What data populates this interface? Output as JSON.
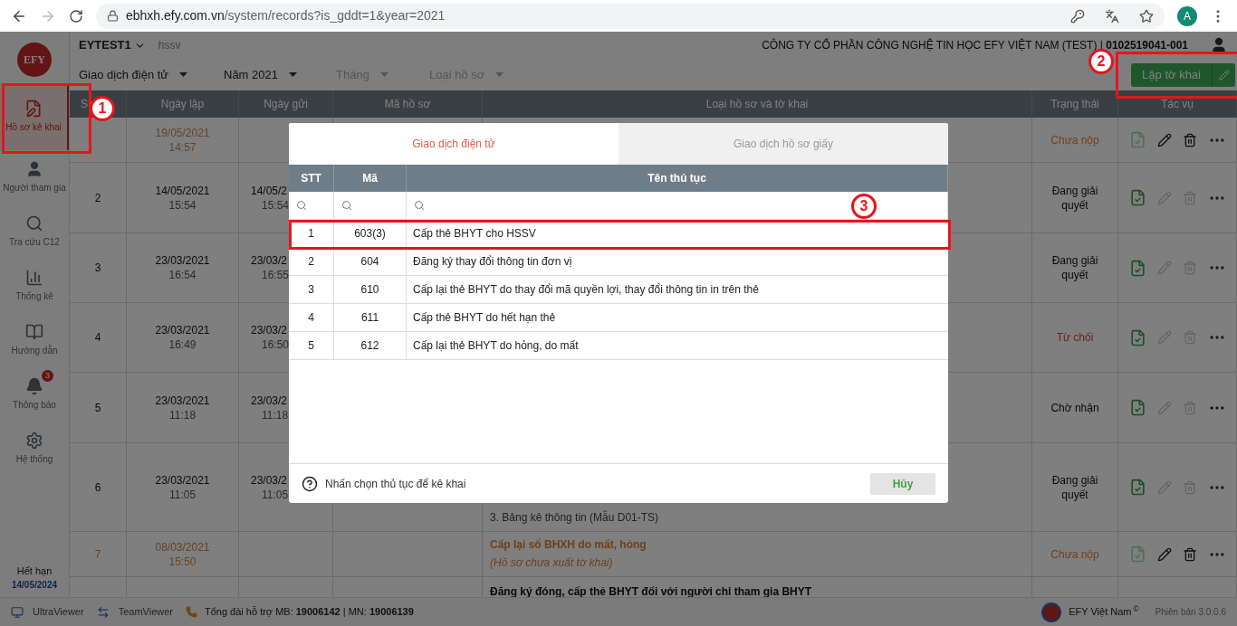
{
  "browser": {
    "url_host": "ebhxh.efy.com.vn",
    "url_path": "/system/records?is_gddt=1&year=2021",
    "avatar": "A"
  },
  "sidebar": {
    "logo": "EFY",
    "items": [
      {
        "label": "Hồ sơ kê khai",
        "selected": true
      },
      {
        "label": "Người tham gia",
        "selected": false
      },
      {
        "label": "Tra cứu C12",
        "selected": false
      },
      {
        "label": "Thống kê",
        "selected": false
      },
      {
        "label": "Hướng dẫn",
        "selected": false
      },
      {
        "label": "Thông báo",
        "badge": "3",
        "selected": false
      },
      {
        "label": "Hệ thống",
        "selected": false
      }
    ],
    "expiry_label": "Hết hạn",
    "expiry_date": "14/05/2024"
  },
  "topbar": {
    "account": "EYTEST1",
    "unit": "hssv",
    "company": "CÔNG TY CỔ PHẦN CÔNG NGHỆ TIN HỌC EFY VIỆT NAM (TEST) | **0102519041-001**"
  },
  "filters": [
    {
      "label": "Giao dịch điện tử",
      "kind": "value"
    },
    {
      "label": "Năm 2021",
      "kind": "value"
    },
    {
      "label": "Tháng",
      "kind": "placeholder"
    },
    {
      "label": "Loại hồ sơ",
      "kind": "placeholder"
    }
  ],
  "create_button": "Lập tờ khai",
  "table": {
    "columns": [
      "S",
      "Ngày lập",
      "Ngày gửi",
      "Mã hồ sơ",
      "Loại hồ sơ và tờ khai",
      "Trạng thái",
      "Tác vụ"
    ],
    "rows": [
      {
        "created_date": "19/05/2021",
        "created_time": "14:57",
        "status": "Chưa nộp",
        "kind": "draft"
      },
      {
        "stt": "2",
        "created_date": "14/05/2021",
        "created_time": "15:54",
        "sent_date": "14/05/2",
        "sent_time": "15:54",
        "status": "Đang giải quyết",
        "kind": "processing"
      },
      {
        "stt": "3",
        "created_date": "23/03/2021",
        "created_time": "16:54",
        "sent_date": "23/03/2",
        "sent_time": "16:55",
        "status": "Đang giải quyết",
        "kind": "processing"
      },
      {
        "stt": "4",
        "created_date": "23/03/2021",
        "created_time": "16:49",
        "sent_date": "23/03/2",
        "sent_time": "16:50",
        "status": "Từ chối",
        "kind": "rejected"
      },
      {
        "stt": "5",
        "created_date": "23/03/2021",
        "created_time": "11:18",
        "sent_date": "23/03/2",
        "sent_time": "11:18",
        "status": "Chờ nhận",
        "kind": "waiting"
      },
      {
        "stt": "6",
        "created_date": "23/03/2021",
        "created_time": "11:05",
        "sent_date": "23/03/2",
        "sent_time": "11:05",
        "type_lines": [
          "3. Bảng kê thông tin (Mẫu D01-TS)"
        ],
        "status": "Đang giải quyết",
        "kind": "processing"
      },
      {
        "stt": "7",
        "created_date": "08/03/2021",
        "created_time": "15:50",
        "type_title": "Cấp lại sổ BHXH do mất, hỏng",
        "type_note": "(Hồ sơ chưa xuất tờ khai)",
        "status": "Chưa nộp",
        "kind": "draft"
      },
      {
        "type_title": "Đăng ký đóng, cấp thẻ BHYT đối với người chỉ tham gia BHYT"
      }
    ]
  },
  "dialog": {
    "tabs": [
      {
        "label": "Giao dịch điện tử",
        "selected": true
      },
      {
        "label": "Giao dịch hồ sơ giấy",
        "selected": false
      }
    ],
    "columns": [
      "STT",
      "Mã",
      "Tên thủ tục"
    ],
    "rows": [
      {
        "stt": "1",
        "code": "603(3)",
        "name": "Cấp thẻ BHYT cho HSSV"
      },
      {
        "stt": "2",
        "code": "604",
        "name": "Đăng ký thay đổi thông tin đơn vị"
      },
      {
        "stt": "3",
        "code": "610",
        "name": "Cấp lại thẻ BHYT do thay đổi mã quyền lợi, thay đổi thông tin in trên thẻ"
      },
      {
        "stt": "4",
        "code": "611",
        "name": "Cấp thẻ BHYT do hết hạn thẻ"
      },
      {
        "stt": "5",
        "code": "612",
        "name": "Cấp lại thẻ BHYT do hỏng, do mất"
      }
    ],
    "hint": "Nhấn chọn thủ tục để kê khai",
    "cancel": "Hủy"
  },
  "annotations": [
    "1",
    "2",
    "3"
  ],
  "footer": {
    "tools": [
      "UltraViewer",
      "TeamViewer"
    ],
    "hotline": "Tổng đài hỗ trợ MB: **19006142** | MN: **19006139**",
    "brand": "EFY Việt Nam",
    "brand_mark": "©",
    "version": "Phiên bản 3.0.0.6"
  }
}
